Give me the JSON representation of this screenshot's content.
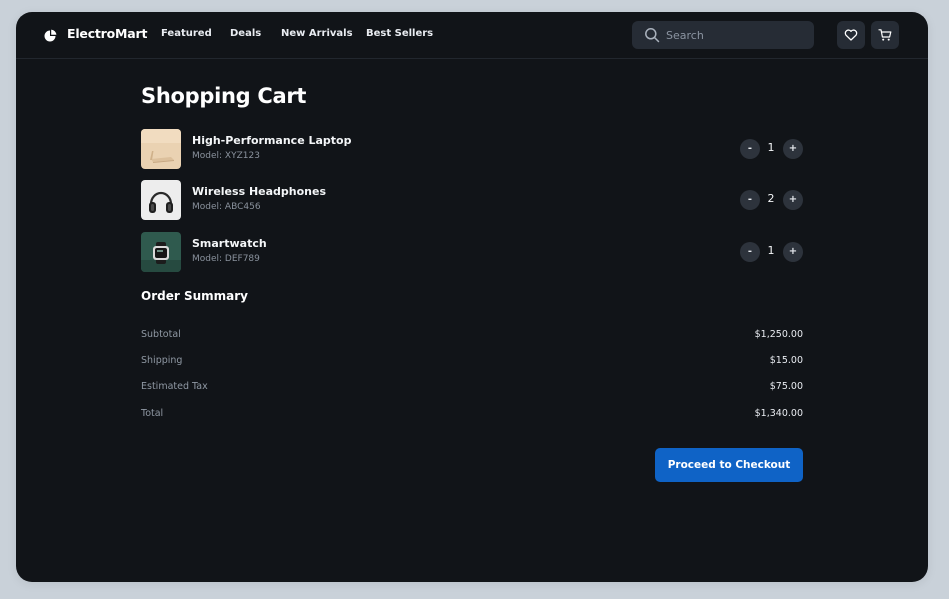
{
  "header": {
    "brand": "ElectroMart",
    "nav": [
      "Featured",
      "Deals",
      "New Arrivals",
      "Best Sellers"
    ],
    "search": {
      "placeholder": "Search",
      "value": ""
    },
    "icons": {
      "wishlist": "heart-icon",
      "cart": "cart-icon",
      "search": "search-icon"
    }
  },
  "cart": {
    "title": "Shopping Cart",
    "items": [
      {
        "name": "High-Performance Laptop",
        "model": "Model: XYZ123",
        "quantity": "1",
        "image": "laptop-thumbnail"
      },
      {
        "name": "Wireless Headphones",
        "model": "Model: ABC456",
        "quantity": "2",
        "image": "headphones-thumbnail"
      },
      {
        "name": "Smartwatch",
        "model": "Model: DEF789",
        "quantity": "1",
        "image": "smartwatch-thumbnail"
      }
    ],
    "decrement_label": "-",
    "increment_label": "+"
  },
  "summary": {
    "title": "Order Summary",
    "rows": [
      {
        "label": "Subtotal",
        "value": "$1,250.00"
      },
      {
        "label": "Shipping",
        "value": "$15.00"
      },
      {
        "label": "Estimated Tax",
        "value": "$75.00"
      },
      {
        "label": "Total",
        "value": "$1,340.00"
      }
    ]
  },
  "checkout": {
    "label": "Proceed to Checkout"
  },
  "colors": {
    "background": "#111418",
    "surface": "#262c35",
    "accent": "#0f63c6",
    "muted_text": "#8a929d"
  }
}
